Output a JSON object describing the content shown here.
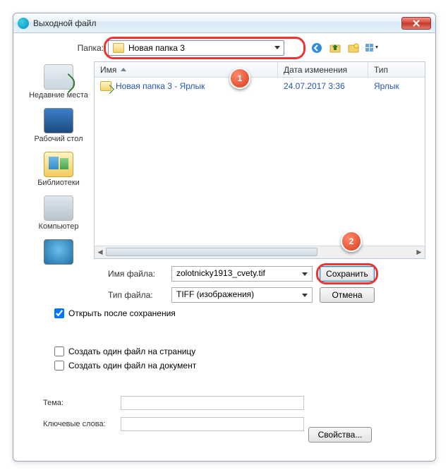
{
  "window": {
    "title": "Выходной файл"
  },
  "folder": {
    "label": "Папка:",
    "value": "Новая папка 3"
  },
  "nav_icons": {
    "back": "back-icon",
    "up": "up-folder-icon",
    "new": "new-folder-icon",
    "views": "views-icon"
  },
  "sidebar": {
    "items": [
      {
        "label": "Недавние места"
      },
      {
        "label": "Рабочий стол"
      },
      {
        "label": "Библиотеки"
      },
      {
        "label": "Компьютер"
      },
      {
        "label": ""
      }
    ]
  },
  "columns": {
    "name": "Имя",
    "date": "Дата изменения",
    "type": "Тип"
  },
  "rows": [
    {
      "name": "Новая папка 3 - Ярлык",
      "date": "24.07.2017 3:36",
      "type": "Ярлык"
    }
  ],
  "file": {
    "name_label": "Имя файла:",
    "name_value": "zolotnicky1913_cvety.tif",
    "type_label": "Тип файла:",
    "type_value": "TIFF (изображения)"
  },
  "buttons": {
    "save": "Сохранить",
    "cancel": "Отмена",
    "props": "Свойства..."
  },
  "checks": {
    "open_after": "Открыть после сохранения",
    "one_per_page": "Создать один файл на страницу",
    "one_per_doc": "Создать один файл на документ"
  },
  "meta": {
    "theme_label": "Тема:",
    "keywords_label": "Ключевые слова:"
  },
  "badges": {
    "b1": "1",
    "b2": "2"
  }
}
